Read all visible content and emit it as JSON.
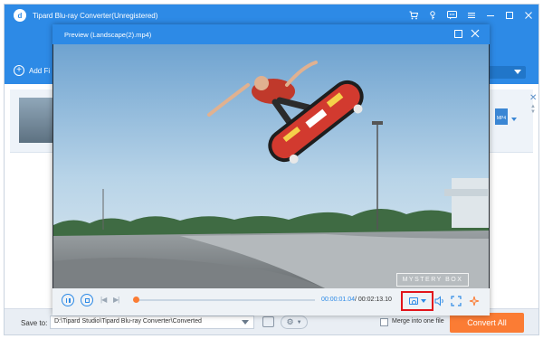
{
  "app": {
    "title": "Tipard Blu-ray Converter(Unregistered)",
    "logo_letter": "d",
    "accent_color": "#2d8ae6",
    "titlebar_icons": [
      "cart-icon",
      "key-icon",
      "feedback-icon",
      "menu-icon",
      "minimize-icon",
      "maximize-icon",
      "close-icon"
    ]
  },
  "toolbar": {
    "add_files_label": "Add Fi"
  },
  "file_row": {
    "format_badge": "MP4"
  },
  "bottom": {
    "save_label": "Save to:",
    "save_path": "D:\\Tipard Studio\\Tipard Blu-ray Converter\\Converted",
    "merge_label": "Merge into one file",
    "merge_checked": false,
    "convert_all_label": "Convert All",
    "convert_color": "#fb7c34"
  },
  "preview": {
    "title": "Preview (Landscape(2).mp4)",
    "watermark": "MYSTERY BOX",
    "current_time": "00:00:01.04",
    "total_time": "/ 00:02:13.10",
    "progress_fraction": 0.01,
    "highlight_color": "#e2141b"
  }
}
